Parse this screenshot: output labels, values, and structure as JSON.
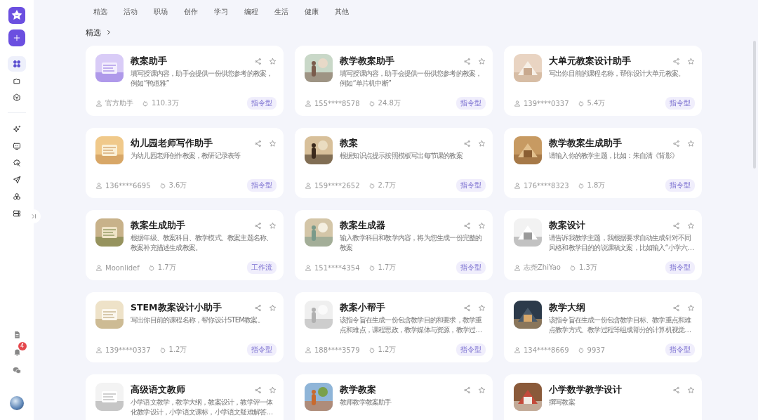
{
  "sidebar": {
    "nav": [
      {
        "selected": true
      },
      {
        "selected": false
      },
      {
        "selected": false
      }
    ],
    "tools": [
      {
        "selected": false
      },
      {
        "selected": false
      },
      {
        "selected": false
      },
      {
        "selected": false
      },
      {
        "selected": false
      },
      {
        "selected": false
      }
    ],
    "notification_badge": "4"
  },
  "tabs": [
    {
      "label": "精选",
      "selected": false
    },
    {
      "label": "活动",
      "selected": false
    },
    {
      "label": "职场",
      "selected": false
    },
    {
      "label": "创作",
      "selected": false
    },
    {
      "label": "学习",
      "selected": false
    },
    {
      "label": "编程",
      "selected": false
    },
    {
      "label": "生活",
      "selected": false
    },
    {
      "label": "健康",
      "selected": false
    },
    {
      "label": "其他",
      "selected": false
    }
  ],
  "section_title": "精选",
  "cards": [
    {
      "title": "教案助手",
      "description": "填写授课内容，助手会提供一份供您参考的教案，例如“鸭道雅”",
      "author": "官方助手",
      "likes": "110.3万",
      "tag": "指令型"
    },
    {
      "title": "教学教案助手",
      "description": "填写授课内容，助手会提供一份供您参考的教案，例如“单片机中断”",
      "author": "155****8578",
      "likes": "24.8万",
      "tag": "指令型"
    },
    {
      "title": "大单元教案设计助手",
      "description": "写出你目前的课程名称，帮你设计大单元教案。",
      "author": "139****0337",
      "likes": "5.4万",
      "tag": "指令型"
    },
    {
      "title": "幼儿园老师写作助手",
      "description": "为幼儿园老师创作教案，教研记录表等",
      "author": "136****6695",
      "likes": "3.6万",
      "tag": "指令型"
    },
    {
      "title": "教案",
      "description": "根据知识点提示按照模板写出每节课的教案",
      "author": "159****2652",
      "likes": "2.7万",
      "tag": "指令型"
    },
    {
      "title": "教学教案生成助手",
      "description": "请输入你的教学主题，比如：朱自清《背影》",
      "author": "176****8323",
      "likes": "1.8万",
      "tag": "指令型"
    },
    {
      "title": "教案生成助手",
      "description": "根据年级、教案科目、教学模式、教案主题名称、教案补充描述生成教案。",
      "author": "Moonlidef",
      "likes": "1.7万",
      "tag": "工作流"
    },
    {
      "title": "教案生成器",
      "description": "输入教学科目和教学内容，将为您生成一份完整的教案",
      "author": "151****4354",
      "likes": "1.7万",
      "tag": "指令型"
    },
    {
      "title": "教案设计",
      "description": "请告诉我教学主题，我根据要求自动生成针对不同风格和教学目的的说课稿文案，比如输入“小学六…",
      "author": "志尧ZhiYao",
      "likes": "1.3万",
      "tag": "指令型"
    },
    {
      "title": "STEM教案设计小助手",
      "description": "写出你目前的课程名称，帮你设计STEM教案。",
      "author": "139****0337",
      "likes": "1.2万",
      "tag": "指令型"
    },
    {
      "title": "教案小帮手",
      "description": "该指令旨在生成一份包含教学目的和要求，教学重点和难点，课程思政，教学媒体与资源，教学过…",
      "author": "188****3579",
      "likes": "1.2万",
      "tag": "指令型"
    },
    {
      "title": "教学大纲",
      "description": "该指令旨在生成一份包含教学目标、教学重点和难点教学方式、教学过程等组成部分的计算机视觉…",
      "author": "134****8669",
      "likes": "9937",
      "tag": "指令型"
    },
    {
      "title": "高级语文教师",
      "description": "小学语文教学，教学大纲，教案设计，教学评一体化教学设计，小学语文课标，小学语文疑难解答…"
    },
    {
      "title": "教学教案",
      "description": "教师教学教案助手"
    },
    {
      "title": "小学数学教学设计",
      "description": "撰写教案"
    }
  ]
}
